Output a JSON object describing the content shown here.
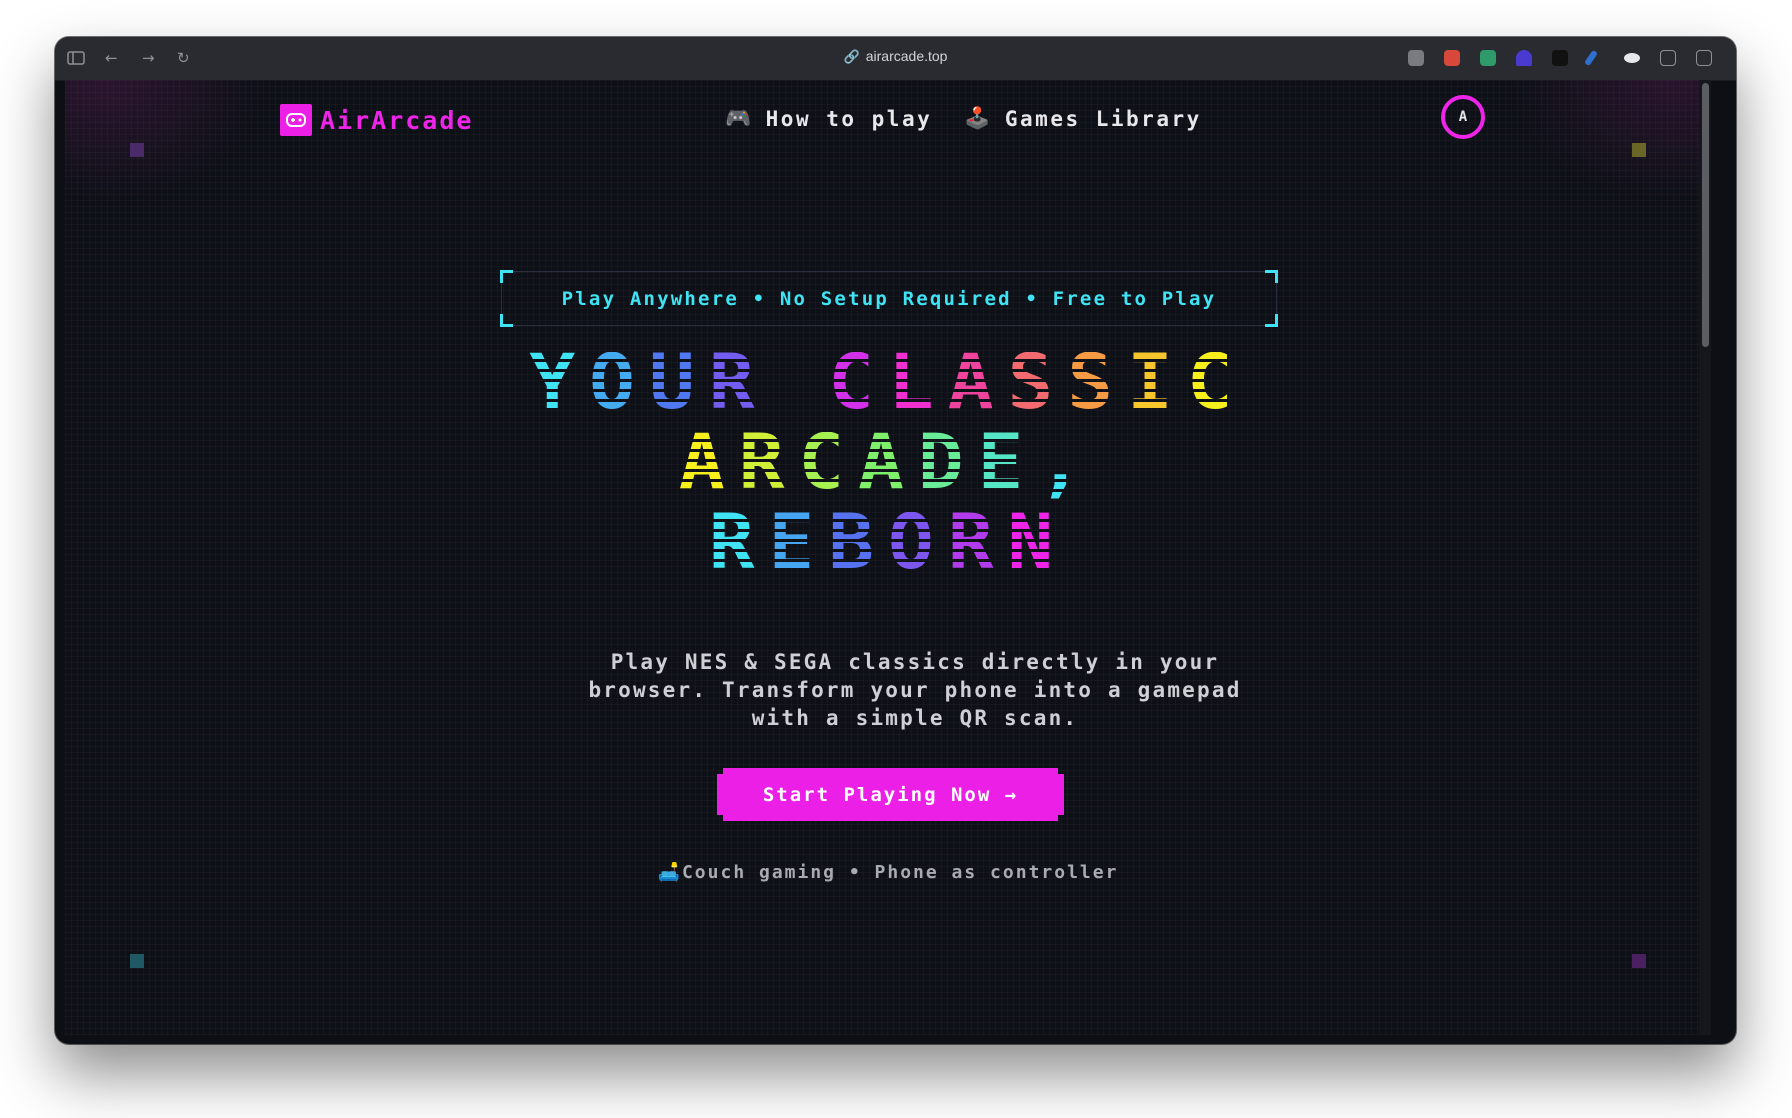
{
  "browser": {
    "url": "airarcade.top",
    "icons": [
      "sidebar-icon",
      "back-icon",
      "forward-icon",
      "reload-icon"
    ],
    "extensions": [
      "camera-extension",
      "mail-extension",
      "t-extension",
      "hat-extension",
      "waveform-extension",
      "pen-extension",
      "disc-extension",
      "share-extension",
      "split-view-icon"
    ]
  },
  "brand": {
    "name": "AirArcade",
    "accent": "#ec1fe6"
  },
  "nav": {
    "items": [
      {
        "icon": "🎮",
        "label": "How to play"
      },
      {
        "icon": "🕹️",
        "label": "Games Library"
      }
    ]
  },
  "user": {
    "avatar_initial": "A"
  },
  "hero": {
    "tagline": "Play Anywhere • No Setup Required • Free to Play",
    "title_line1": "YOUR CLASSIC",
    "title_line2": "ARCADE,",
    "title_line3": "REBORN",
    "description": "Play NES & SEGA classics directly in your browser. Transform your phone into a gamepad with a simple QR scan.",
    "cta_label": "Start Playing Now →",
    "footnote": "🛋️Couch gaming • Phone as controller"
  },
  "colors": {
    "background": "#0e1017",
    "cyan": "#40e3f3",
    "magenta": "#ee25e8",
    "yellow": "#f7f01c",
    "green": "#7ef06a",
    "blue": "#4a7cf0",
    "purple": "#8a4cf0",
    "orange": "#f7a33c"
  }
}
